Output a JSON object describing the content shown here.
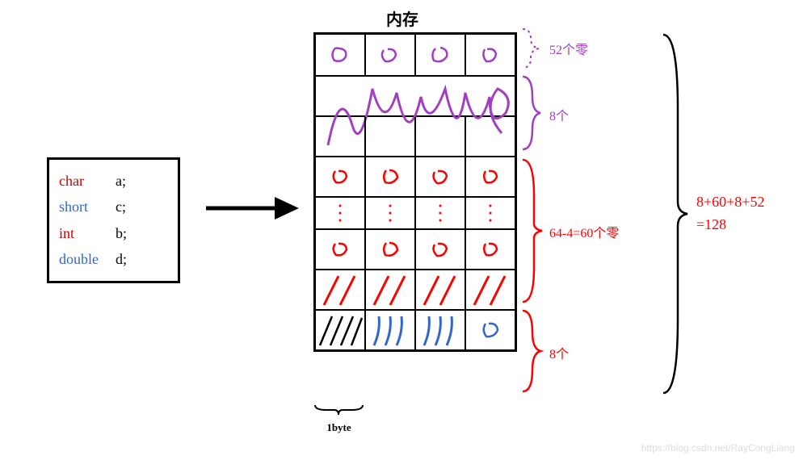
{
  "title": "内存",
  "struct": {
    "rows": [
      {
        "kw": "char",
        "var": "a;",
        "color_class": "kw-char"
      },
      {
        "kw": "short",
        "var": "c;",
        "color_class": "kw-short"
      },
      {
        "kw": "int",
        "var": "b;",
        "color_class": "kw-int"
      },
      {
        "kw": "double",
        "var": "d;",
        "color_class": "kw-double"
      }
    ]
  },
  "byte_label": "1byte",
  "annotations": {
    "zeros52": "52个零",
    "eight_top": "8个",
    "zeros60": "64-4=60个零",
    "eight_bot": "8个",
    "sum1": "8+60+8+52",
    "sum2": "=128"
  },
  "watermark": "https://blog.csdn.net/RayCongLiang",
  "chart_data": {
    "type": "diagram",
    "description": "Memory alignment layout diagram for C struct members (char a; short c; int b; double d;) showing byte allocation and padding",
    "members": [
      {
        "name": "a",
        "type": "char",
        "size_bytes": 1
      },
      {
        "name": "c",
        "type": "short",
        "size_bytes": 2
      },
      {
        "name": "b",
        "type": "int",
        "size_bytes": 4
      },
      {
        "name": "d",
        "type": "double",
        "size_bytes": 8
      }
    ],
    "memory_blocks_from_top": [
      {
        "label": "52个零",
        "bytes": 52,
        "content": "zero padding (purple zeros)"
      },
      {
        "label": "8个",
        "bytes": 8,
        "content": "filled purple region (double d)"
      },
      {
        "label": "64-4=60个零",
        "bytes": 60,
        "content": "zero padding (red zeros)"
      },
      {
        "label": "8个",
        "bytes": 8,
        "content": "bottom filled region: 1 char (black hatch) + 2 short (blue hatch, gap) + 4 int (red hatch row) + 1 blue zero pad"
      }
    ],
    "total_formula": "8+60+8+52",
    "total_bytes": 128,
    "grid_columns": 4,
    "cell_unit": "1byte"
  }
}
